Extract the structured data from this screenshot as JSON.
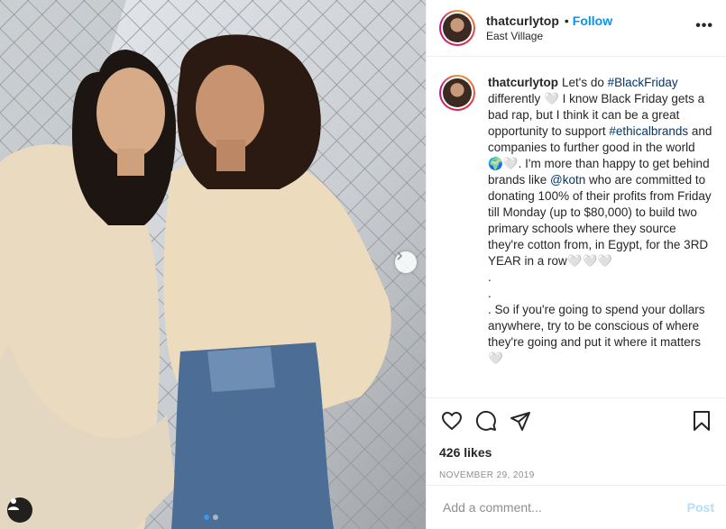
{
  "post": {
    "username": "thatcurlytop",
    "follow_label": "Follow",
    "bullet": "•",
    "location": "East Village",
    "more_label": "•••"
  },
  "caption": {
    "username": "thatcurlytop",
    "segments": [
      {
        "type": "text",
        "value": "Let's do "
      },
      {
        "type": "tag",
        "value": "#BlackFriday"
      },
      {
        "type": "text",
        "value": " differently 🤍 I know Black Friday gets a bad rap, but I think it can be a great opportunity to support "
      },
      {
        "type": "tag",
        "value": "#ethicalbrands"
      },
      {
        "type": "text",
        "value": " and companies to further good in the world 🌍🤍. I'm more than happy to get behind brands like "
      },
      {
        "type": "tag",
        "value": "@kotn"
      },
      {
        "type": "text",
        "value": " who are committed to donating 100% of their profits from Friday till Monday (up to $80,000) to build two primary schools where they source they're cotton from, in Egypt, for the 3RD YEAR in a row🤍🤍🤍"
      },
      {
        "type": "br"
      },
      {
        "type": "text",
        "value": "."
      },
      {
        "type": "br"
      },
      {
        "type": "text",
        "value": "."
      },
      {
        "type": "br"
      },
      {
        "type": "text",
        "value": ". So if you're going to spend your dollars anywhere, try to be conscious of where they're going and put it where it matters 🤍"
      }
    ]
  },
  "actions": {
    "like_icon": "heart-icon",
    "comment_icon": "comment-icon",
    "share_icon": "share-icon",
    "save_icon": "bookmark-icon"
  },
  "likes": "426 likes",
  "date": "NOVEMBER 29, 2019",
  "comment_box": {
    "placeholder": "Add a comment...",
    "post_label": "Post"
  },
  "carousel": {
    "total": 2,
    "active_index": 0
  },
  "colors": {
    "accent": "#0095f6",
    "post_disabled": "#b2dffc",
    "hashtag": "#00376b",
    "carousel_active": "#3897f0"
  }
}
